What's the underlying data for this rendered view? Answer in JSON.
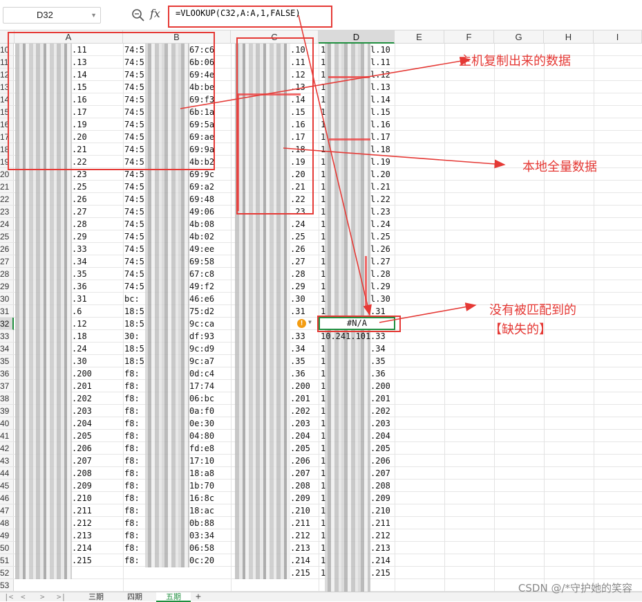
{
  "formula_bar": {
    "name_box": "D32",
    "fx_label": "fx",
    "formula": "=VLOOKUP(C32,A:A,1,FALSE)"
  },
  "columns": [
    "A",
    "B",
    "C",
    "D",
    "E",
    "F",
    "G",
    "H",
    "I"
  ],
  "selected_column": "D",
  "rows": [
    {
      "n": "10",
      "a": ".11",
      "b1": "74:5",
      "b2": "67:c6",
      "c": ".10",
      "d1": "1",
      "d2": "l.10"
    },
    {
      "n": "11",
      "a": ".13",
      "b1": "74:5",
      "b2": "6b:06",
      "c": ".11",
      "d1": "1",
      "d2": "l.11"
    },
    {
      "n": "12",
      "a": ".14",
      "b1": "74:5",
      "b2": "69:4e",
      "c": ".12",
      "d1": "1",
      "d2": "l.12"
    },
    {
      "n": "13",
      "a": ".15",
      "b1": "74:5",
      "b2": "4b:be",
      "c": ".13",
      "d1": "1",
      "d2": "l.13"
    },
    {
      "n": "14",
      "a": ".16",
      "b1": "74:5",
      "b2": "69:f3",
      "c": ".14",
      "d1": "1",
      "d2": "l.14"
    },
    {
      "n": "15",
      "a": ".17",
      "b1": "74:5",
      "b2": "6b:1a",
      "c": ".15",
      "d1": "1",
      "d2": "l.15"
    },
    {
      "n": "16",
      "a": ".19",
      "b1": "74:5",
      "b2": "69:5a",
      "c": ".16",
      "d1": "1",
      "d2": "l.16"
    },
    {
      "n": "17",
      "a": ".20",
      "b1": "74:5",
      "b2": "69:ae",
      "c": ".17",
      "d1": "1",
      "d2": "l.17"
    },
    {
      "n": "18",
      "a": ".21",
      "b1": "74:5",
      "b2": "69:9a",
      "c": ".18",
      "d1": "1",
      "d2": "l.18"
    },
    {
      "n": "19",
      "a": ".22",
      "b1": "74:5",
      "b2": "4b:b2",
      "c": ".19",
      "d1": "1",
      "d2": "l.19"
    },
    {
      "n": "20",
      "a": ".23",
      "b1": "74:5",
      "b2": "69:9c",
      "c": ".20",
      "d1": "1",
      "d2": "l.20"
    },
    {
      "n": "21",
      "a": ".25",
      "b1": "74:5",
      "b2": "69:a2",
      "c": ".21",
      "d1": "1",
      "d2": "l.21"
    },
    {
      "n": "22",
      "a": ".26",
      "b1": "74:5",
      "b2": "69:48",
      "c": ".22",
      "d1": "1",
      "d2": "l.22"
    },
    {
      "n": "23",
      "a": ".27",
      "b1": "74:5",
      "b2": "49:06",
      "c": ".23",
      "d1": "1",
      "d2": "l.23"
    },
    {
      "n": "24",
      "a": ".28",
      "b1": "74:5",
      "b2": "4b:08",
      "c": ".24",
      "d1": "1",
      "d2": "l.24"
    },
    {
      "n": "25",
      "a": ".29",
      "b1": "74:5",
      "b2": "4b:02",
      "c": ".25",
      "d1": "1",
      "d2": "l.25"
    },
    {
      "n": "26",
      "a": ".33",
      "b1": "74:5",
      "b2": "49:ee",
      "c": ".26",
      "d1": "1",
      "d2": "l.26"
    },
    {
      "n": "27",
      "a": ".34",
      "b1": "74:5",
      "b2": "69:58",
      "c": ".27",
      "d1": "1",
      "d2": "l.27"
    },
    {
      "n": "28",
      "a": ".35",
      "b1": "74:5",
      "b2": "67:c8",
      "c": ".28",
      "d1": "1",
      "d2": "l.28"
    },
    {
      "n": "29",
      "a": ".36",
      "b1": "74:5",
      "b2": "49:f2",
      "c": ".29",
      "d1": "1",
      "d2": "l.29"
    },
    {
      "n": "30",
      "a": ".31",
      "b1": "bc:",
      "b2": "46:e6",
      "c": ".30",
      "d1": "1",
      "d2": "l.30"
    },
    {
      "n": "31",
      "a": ".6",
      "b1": "18:5",
      "b2": "75:d2",
      "c": ".31",
      "d1": "1",
      "d2": ".31"
    },
    {
      "n": "32",
      "a": ".12",
      "b1": "18:5",
      "b2": "9c:ca",
      "c": "",
      "d1": "",
      "d2": ""
    },
    {
      "n": "33",
      "a": ".18",
      "b1": "30:",
      "b2": "df:93",
      "c": ".33",
      "d1": "10.241.101",
      "d2": ".33"
    },
    {
      "n": "34",
      "a": ".24",
      "b1": "18:5",
      "b2": "9c:d9",
      "c": ".34",
      "d1": "1",
      "d2": ".34"
    },
    {
      "n": "35",
      "a": ".30",
      "b1": "18:5",
      "b2": "9c:a7",
      "c": ".35",
      "d1": "1",
      "d2": ".35"
    },
    {
      "n": "36",
      "a": ".200",
      "b1": "f8:",
      "b2": "0d:c4",
      "c": ".36",
      "d1": "1",
      "d2": ".36"
    },
    {
      "n": "37",
      "a": ".201",
      "b1": "f8:",
      "b2": "17:74",
      "c": ".200",
      "d1": "1",
      "d2": ".200"
    },
    {
      "n": "38",
      "a": ".202",
      "b1": "f8:",
      "b2": "06:bc",
      "c": ".201",
      "d1": "1",
      "d2": ".201"
    },
    {
      "n": "39",
      "a": ".203",
      "b1": "f8:",
      "b2": "0a:f0",
      "c": ".202",
      "d1": "1",
      "d2": ".202"
    },
    {
      "n": "40",
      "a": ".204",
      "b1": "f8:",
      "b2": "0e:30",
      "c": ".203",
      "d1": "1",
      "d2": ".203"
    },
    {
      "n": "41",
      "a": ".205",
      "b1": "f8:",
      "b2": "04:80",
      "c": ".204",
      "d1": "1",
      "d2": ".204"
    },
    {
      "n": "42",
      "a": ".206",
      "b1": "f8:",
      "b2": "fd:e8",
      "c": ".205",
      "d1": "1",
      "d2": ".205"
    },
    {
      "n": "43",
      "a": ".207",
      "b1": "f8:",
      "b2": "17:10",
      "c": ".206",
      "d1": "1",
      "d2": ".206"
    },
    {
      "n": "44",
      "a": ".208",
      "b1": "f8:",
      "b2": "18:a8",
      "c": ".207",
      "d1": "1",
      "d2": ".207"
    },
    {
      "n": "45",
      "a": ".209",
      "b1": "f8:",
      "b2": "1b:70",
      "c": ".208",
      "d1": "1",
      "d2": ".208"
    },
    {
      "n": "46",
      "a": ".210",
      "b1": "f8:",
      "b2": "16:8c",
      "c": ".209",
      "d1": "1",
      "d2": ".209"
    },
    {
      "n": "47",
      "a": ".211",
      "b1": "f8:",
      "b2": "18:ac",
      "c": ".210",
      "d1": "1",
      "d2": ".210"
    },
    {
      "n": "48",
      "a": ".212",
      "b1": "f8:",
      "b2": "0b:88",
      "c": ".211",
      "d1": "1",
      "d2": ".211"
    },
    {
      "n": "49",
      "a": ".213",
      "b1": "f8:",
      "b2": "03:34",
      "c": ".212",
      "d1": "1",
      "d2": ".212"
    },
    {
      "n": "50",
      "a": ".214",
      "b1": "f8:",
      "b2": "06:58",
      "c": ".213",
      "d1": "1",
      "d2": ".213"
    },
    {
      "n": "51",
      "a": ".215",
      "b1": "f8:",
      "b2": "0c:20",
      "c": ".214",
      "d1": "1",
      "d2": ".214"
    },
    {
      "n": "52",
      "a": "",
      "b1": "",
      "b2": "",
      "c": ".215",
      "d1": "1",
      "d2": ".215"
    },
    {
      "n": "53",
      "a": "",
      "b1": "",
      "b2": "",
      "c": "",
      "d1": "",
      "d2": ""
    }
  ],
  "active_cell": {
    "value": "#N/A"
  },
  "annotations": {
    "host_copy": "主机复制出来的数据",
    "local_full": "本地全量数据",
    "missing_line1": "没有被匹配到的",
    "missing_line2": "【缺失的】"
  },
  "sheet_tabs": [
    "三期",
    "四期",
    "五期"
  ],
  "active_tab": "五期",
  "watermark": "CSDN @/*守护她的笑容",
  "colors": {
    "annotation_red": "#e53935",
    "selection_green": "#1e8e3e"
  }
}
